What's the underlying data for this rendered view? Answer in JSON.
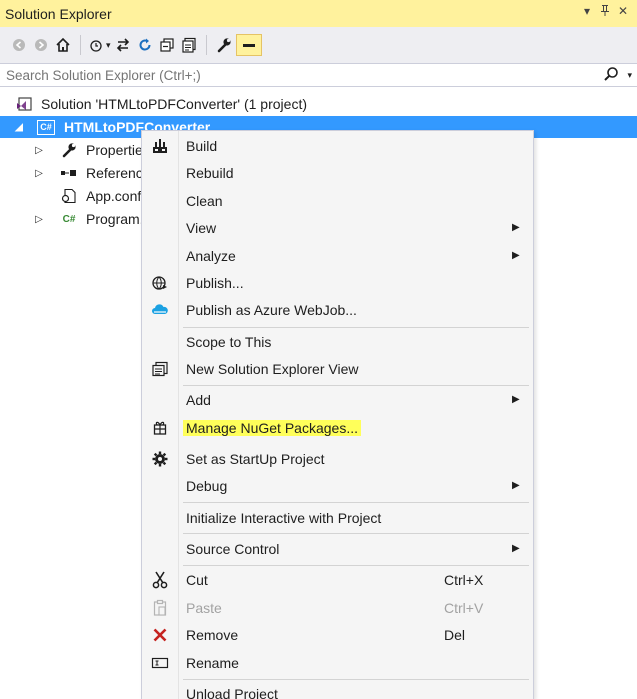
{
  "window": {
    "title": "Solution Explorer",
    "pin_glyph": "▾",
    "autohide_glyph": "ᵽ",
    "close_glyph": "✕"
  },
  "toolbar": {
    "buttons": [
      {
        "name": "back-icon",
        "glyph": "◀"
      },
      {
        "name": "forward-icon",
        "glyph": "▶"
      },
      {
        "name": "home-icon",
        "glyph": "⌂"
      },
      {
        "name": "pending-changes-icon",
        "glyph": "↻"
      },
      {
        "name": "sync-icon",
        "glyph": "⇆"
      },
      {
        "name": "refresh-icon",
        "glyph": "⟳"
      },
      {
        "name": "collapse-all-icon",
        "glyph": "⧉"
      },
      {
        "name": "show-all-files-icon",
        "glyph": "⎘"
      },
      {
        "name": "properties-icon",
        "glyph": "🔧"
      },
      {
        "name": "preview-icon",
        "glyph": "▬"
      }
    ]
  },
  "search": {
    "placeholder": "Search Solution Explorer (Ctrl+;)",
    "icon": "search-icon"
  },
  "tree": {
    "solution_label": "Solution 'HTMLtoPDFConverter' (1 project)",
    "project_label": "HTMLtoPDFConverter",
    "project_badge": "C#",
    "items": [
      {
        "label": "Properties",
        "icon": "wrench-icon"
      },
      {
        "label": "References",
        "icon": "references-icon"
      },
      {
        "label": "App.config",
        "icon": "config-file-icon"
      },
      {
        "label": "Program.cs",
        "icon": "csharp-file-icon",
        "badge": "C#"
      }
    ]
  },
  "menu": {
    "items": [
      {
        "label": "Build",
        "icon": "build-icon"
      },
      {
        "label": "Rebuild"
      },
      {
        "label": "Clean"
      },
      {
        "label": "View",
        "submenu": true
      },
      {
        "label": "Analyze",
        "submenu": true
      },
      {
        "label": "Publish...",
        "icon": "publish-icon"
      },
      {
        "label": "Publish as Azure WebJob...",
        "icon": "azure-cloud-icon"
      },
      {
        "label": "Scope to This"
      },
      {
        "label": "New Solution Explorer View",
        "icon": "new-view-icon"
      },
      {
        "label": "Add",
        "submenu": true
      },
      {
        "label": "Manage NuGet Packages...",
        "icon": "nuget-icon",
        "highlighted": true
      },
      {
        "label": "Set as StartUp Project",
        "icon": "gear-icon"
      },
      {
        "label": "Debug",
        "submenu": true
      },
      {
        "label": "Initialize Interactive with Project"
      },
      {
        "label": "Source Control",
        "submenu": true
      },
      {
        "label": "Cut",
        "icon": "scissors-icon",
        "shortcut": "Ctrl+X"
      },
      {
        "label": "Paste",
        "icon": "paste-icon",
        "shortcut": "Ctrl+V",
        "disabled": true
      },
      {
        "label": "Remove",
        "icon": "remove-icon",
        "shortcut": "Del"
      },
      {
        "label": "Rename",
        "icon": "rename-icon"
      },
      {
        "label": "Unload Project"
      }
    ]
  },
  "colors": {
    "title_bar": "#fff29d",
    "selection": "#3399ff",
    "highlight": "#ffff5a",
    "menu_bg": "#f5f5f5"
  }
}
